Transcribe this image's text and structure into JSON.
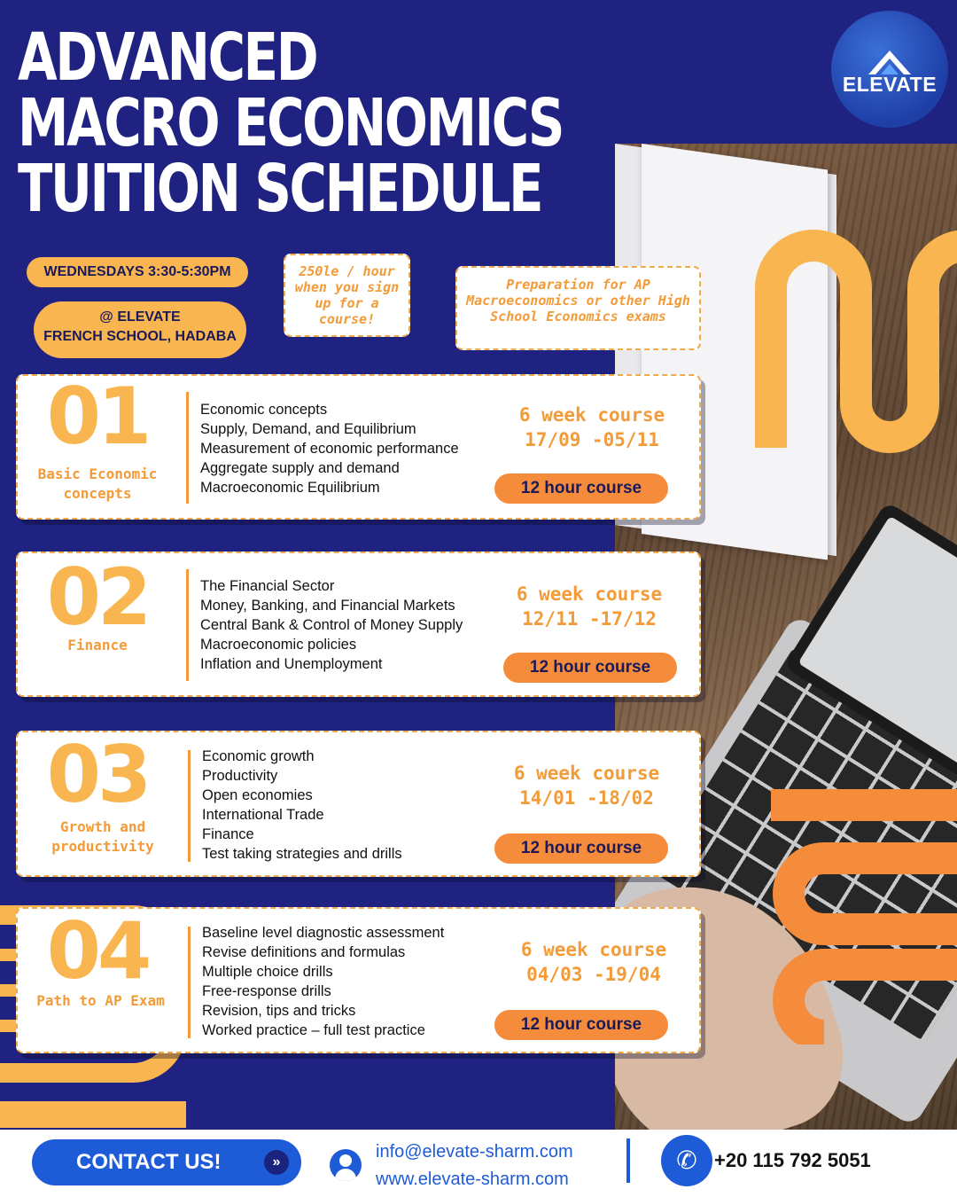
{
  "title": [
    "ADVANCED",
    "MACRO ECONOMICS",
    "TUITION SCHEDULE"
  ],
  "logo": {
    "text": "ELEVATE",
    "icon": "mountain-icon"
  },
  "schedule": {
    "when": "WEDNESDAYS 3:30-5:30PM",
    "where_line1": "@ ELEVATE",
    "where_line2": "FRENCH SCHOOL, HADABA"
  },
  "price_note": "250le / hour when you sign up for a course!",
  "prep_note": "Preparation for AP Macroeconomics or other High School Economics exams",
  "modules": [
    {
      "number": "01",
      "name": "Basic Economic concepts",
      "topics": [
        "Economic concepts",
        "Supply, Demand, and Equilibrium",
        "Measurement of economic performance",
        "Aggregate supply and demand",
        "Macroeconomic Equilibrium"
      ],
      "duration": "6 week course",
      "dates": "17/09 -05/11",
      "hours": "12 hour course"
    },
    {
      "number": "02",
      "name": "Finance",
      "topics": [
        "The Financial Sector",
        "Money, Banking, and Financial Markets",
        "Central Bank & Control of  Money Supply",
        "Macroeconomic policies",
        "Inflation and Unemployment"
      ],
      "duration": "6 week course",
      "dates": "12/11 -17/12",
      "hours": "12 hour course"
    },
    {
      "number": "03",
      "name": "Growth and productivity",
      "topics": [
        "Economic growth",
        "Productivity",
        "Open economies",
        "International Trade",
        "Finance",
        "Test taking strategies and drills"
      ],
      "duration": "6 week course",
      "dates": "14/01 -18/02",
      "hours": "12 hour course"
    },
    {
      "number": "04",
      "name": "Path to AP Exam",
      "topics": [
        "Baseline level diagnostic assessment",
        "Revise definitions and formulas",
        "Multiple choice drills",
        "Free-response drills",
        "Revision, tips and tricks",
        "Worked practice – full test practice"
      ],
      "duration": "6 week course",
      "dates": "04/03 -19/04",
      "hours": "12 hour course"
    }
  ],
  "footer": {
    "contact_label": "CONTACT US!",
    "contact_icon": "double-chevron-right-icon",
    "email": "info@elevate-sharm.com",
    "website": "www.elevate-sharm.com",
    "phone": "+20 115 792 5051",
    "phone_icon": "phone-icon",
    "user_icon": "user-icon"
  },
  "colors": {
    "background": "#1f2280",
    "accent": "#f9b650",
    "accent_dark": "#f58c3c",
    "brand_blue": "#1e5bd6"
  }
}
